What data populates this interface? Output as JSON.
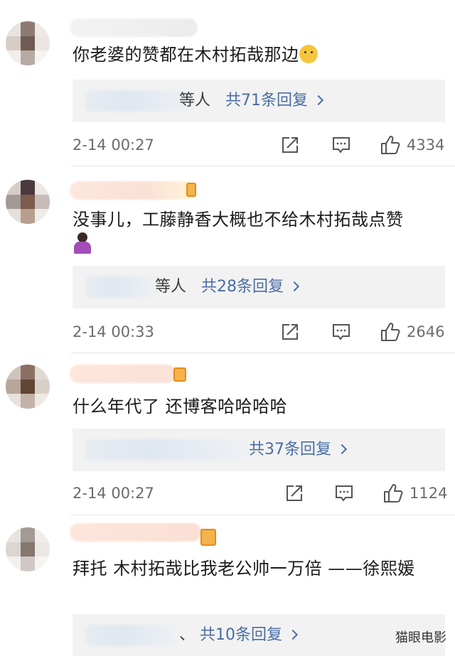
{
  "comments": [
    {
      "text": "你老婆的赞都在木村拓哉那边",
      "emoji": "doge-emoji",
      "reply_suffix": "等人",
      "reply_count": "共71条回复",
      "timestamp": "2-14 00:27",
      "likes": "4334"
    },
    {
      "text": "没事儿，工藤静香大概也不给木村拓哉点赞",
      "emoji": "person-shrugging-emoji",
      "reply_suffix": "等人",
      "reply_count": "共28条回复",
      "timestamp": "2-14 00:33",
      "likes": "2646"
    },
    {
      "text": "什么年代了 还博客哈哈哈哈",
      "reply_suffix": "",
      "reply_count": "共37条回复",
      "timestamp": "2-14 00:27",
      "likes": "1124"
    },
    {
      "text": "拜托 木村拓哉比我老公帅一万倍 ——徐熙媛",
      "reply_suffix": "、",
      "reply_count": "共10条回复"
    }
  ],
  "watermark": "猫眼电影",
  "icons": {
    "share": "share-icon",
    "comment": "comment-icon",
    "like": "thumbs-up-icon"
  },
  "colors": {
    "link": "#4a6ea4",
    "meta": "#6c6c6c",
    "reply_bg": "#f2f2f2"
  }
}
